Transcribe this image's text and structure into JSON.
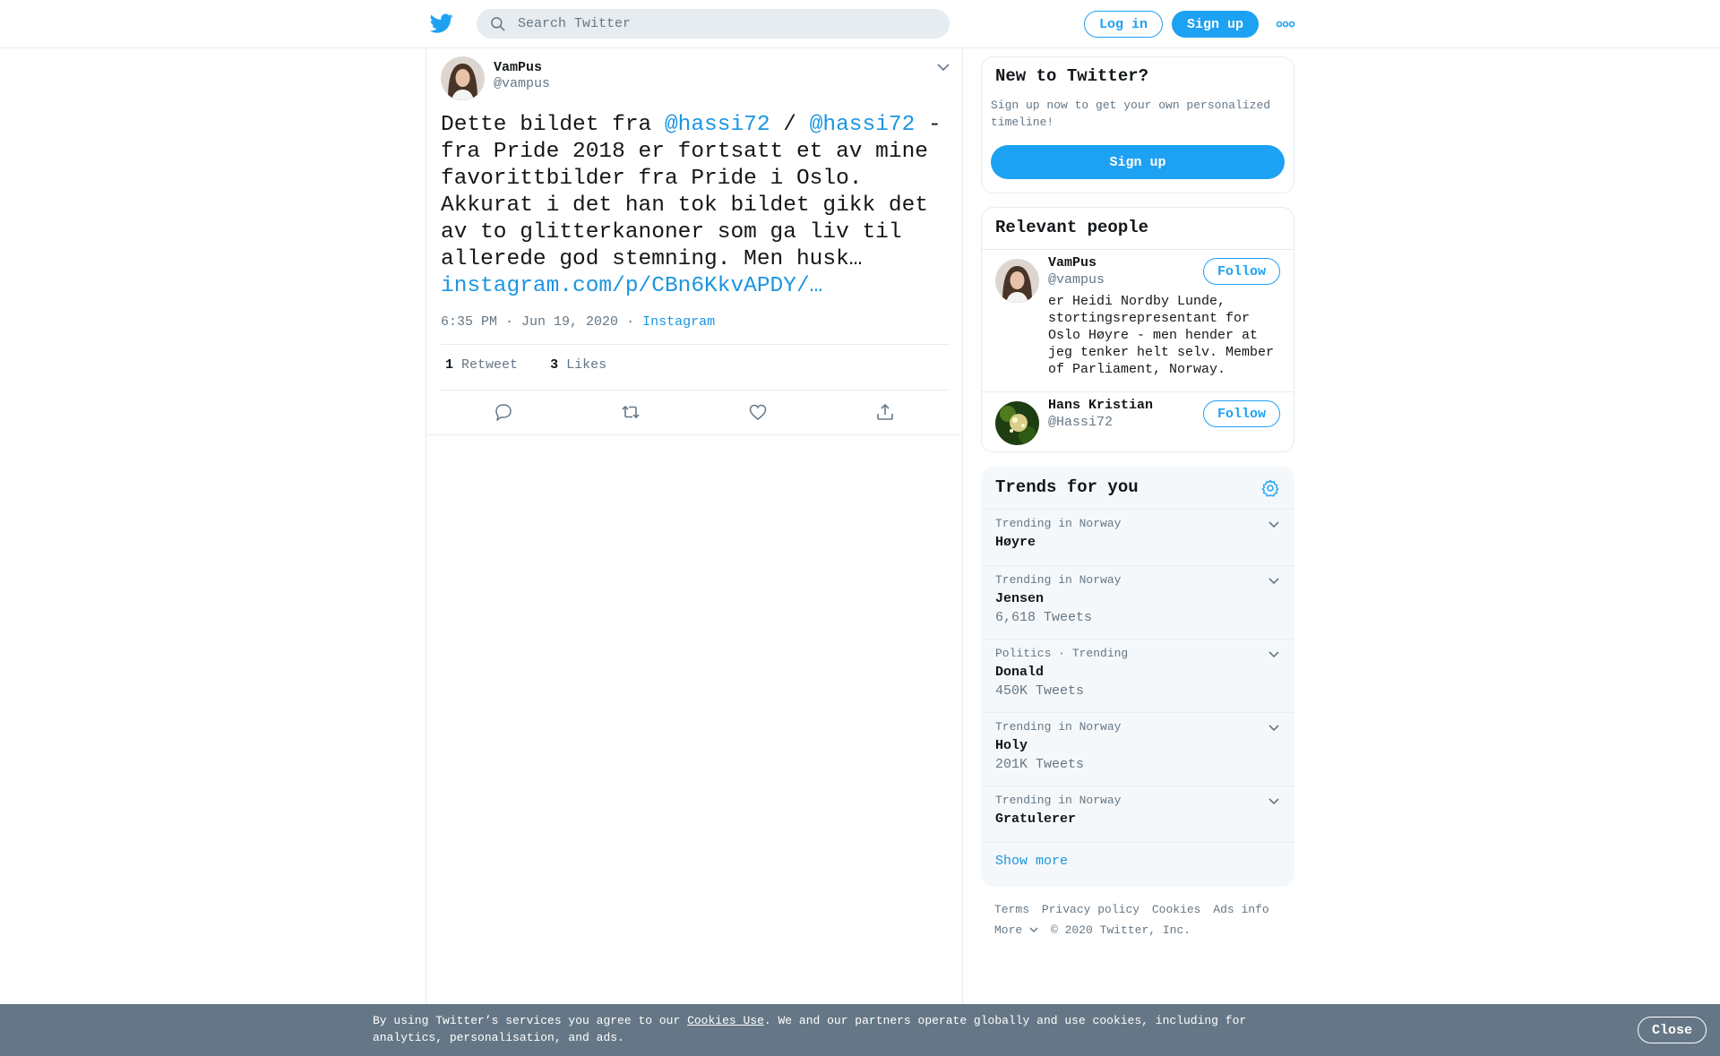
{
  "header": {
    "search_placeholder": "Search Twitter",
    "login_label": "Log in",
    "signup_label": "Sign up"
  },
  "tweet": {
    "author_name": "VamPus",
    "author_handle": "@vampus",
    "text_1": "Dette bildet fra ",
    "mention_1": "@hassi72",
    "text_2": " / ",
    "mention_2": "@hassi72",
    "text_3": " - fra Pride 2018 er fortsatt et av mine favorittbilder fra Pride i Oslo. Akkurat i det han tok bildet gikk det av to glitterkanoner som ga liv til allerede god stemning. Men husk…",
    "link": "instagram.com/p/CBn6KkvAPDY/…",
    "time": "6:35 PM · Jun 19, 2020",
    "separator": "·",
    "source": "Instagram",
    "retweet_count": "1",
    "retweet_label": "Retweet",
    "like_count": "3",
    "like_label": "Likes"
  },
  "sidebar": {
    "new_title": "New to Twitter?",
    "new_text": "Sign up now to get your own personalized timeline!",
    "new_button": "Sign up",
    "relevant_title": "Relevant people",
    "people": [
      {
        "name": "VamPus",
        "handle": "@vampus",
        "bio": "er Heidi Nordby Lunde, stortingsrepresentant for Oslo Høyre - men hender at jeg tenker helt selv. Member of Parliament, Norway.",
        "follow_label": "Follow"
      },
      {
        "name": "Hans Kristian",
        "handle": "@Hassi72",
        "follow_label": "Follow"
      }
    ],
    "trends_title": "Trends for you",
    "trends": [
      {
        "context": "Trending in Norway",
        "name": "Høyre",
        "count": ""
      },
      {
        "context": "Trending in Norway",
        "name": "Jensen",
        "count": "6,618 Tweets"
      },
      {
        "context": "Politics · Trending",
        "name": "Donald",
        "count": "450K Tweets"
      },
      {
        "context": "Trending in Norway",
        "name": "Holy",
        "count": "201K Tweets"
      },
      {
        "context": "Trending in Norway",
        "name": "Gratulerer",
        "count": ""
      }
    ],
    "show_more": "Show more"
  },
  "footer": {
    "links": [
      "Terms",
      "Privacy policy",
      "Cookies",
      "Ads info"
    ],
    "more": "More",
    "copyright": "© 2020 Twitter, Inc."
  },
  "cookie": {
    "text_before": "By using Twitter’s services you agree to our ",
    "link": "Cookies Use",
    "text_after": ". We and our partners operate globally and use cookies, including for analytics, personalisation, and ads.",
    "close_label": "Close"
  },
  "colors": {
    "accent": "#1da1f2",
    "link": "#1b95e0",
    "muted": "#657786",
    "cookie_bar": "#657786"
  }
}
